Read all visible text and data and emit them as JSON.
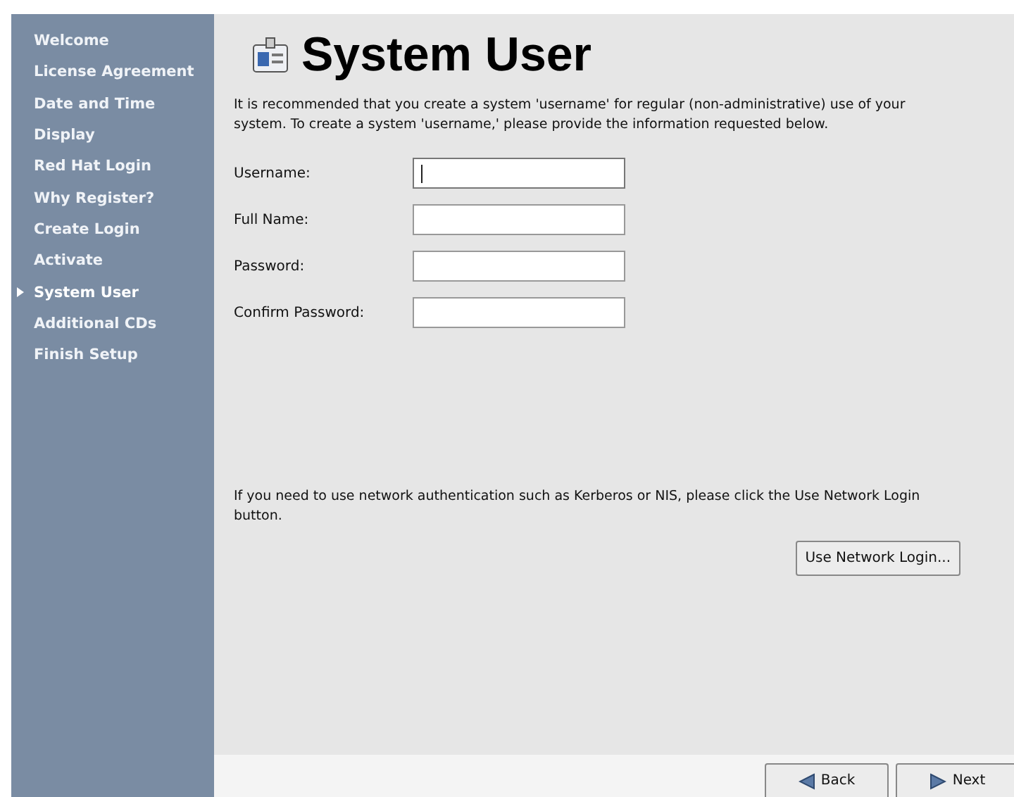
{
  "sidebar": {
    "items": [
      {
        "label": "Welcome",
        "selected": false
      },
      {
        "label": "License Agreement",
        "selected": false
      },
      {
        "label": "Date and Time",
        "selected": false
      },
      {
        "label": "Display",
        "selected": false
      },
      {
        "label": "Red Hat Login",
        "selected": false
      },
      {
        "label": "Why Register?",
        "selected": false
      },
      {
        "label": "Create Login",
        "selected": false
      },
      {
        "label": "Activate",
        "selected": false
      },
      {
        "label": "System User",
        "selected": true
      },
      {
        "label": "Additional CDs",
        "selected": false
      },
      {
        "label": "Finish Setup",
        "selected": false
      }
    ]
  },
  "page": {
    "title": "System User",
    "intro": "It is recommended that you create a system 'username' for regular (non-administrative) use of your system. To create a system 'username,' please provide the information requested below.",
    "fields": [
      {
        "label": "Username:",
        "focused": true
      },
      {
        "label": "Full Name:",
        "focused": false
      },
      {
        "label": "Password:",
        "focused": false
      },
      {
        "label": "Confirm Password:",
        "focused": false
      }
    ],
    "network_note": "If you need to use network authentication such as Kerberos or NIS, please click the Use Network Login button.",
    "network_button": "Use Network Login..."
  },
  "footer": {
    "buttons": [
      {
        "label": "Back",
        "kind": "back"
      },
      {
        "label": "Next",
        "kind": "next"
      }
    ]
  }
}
